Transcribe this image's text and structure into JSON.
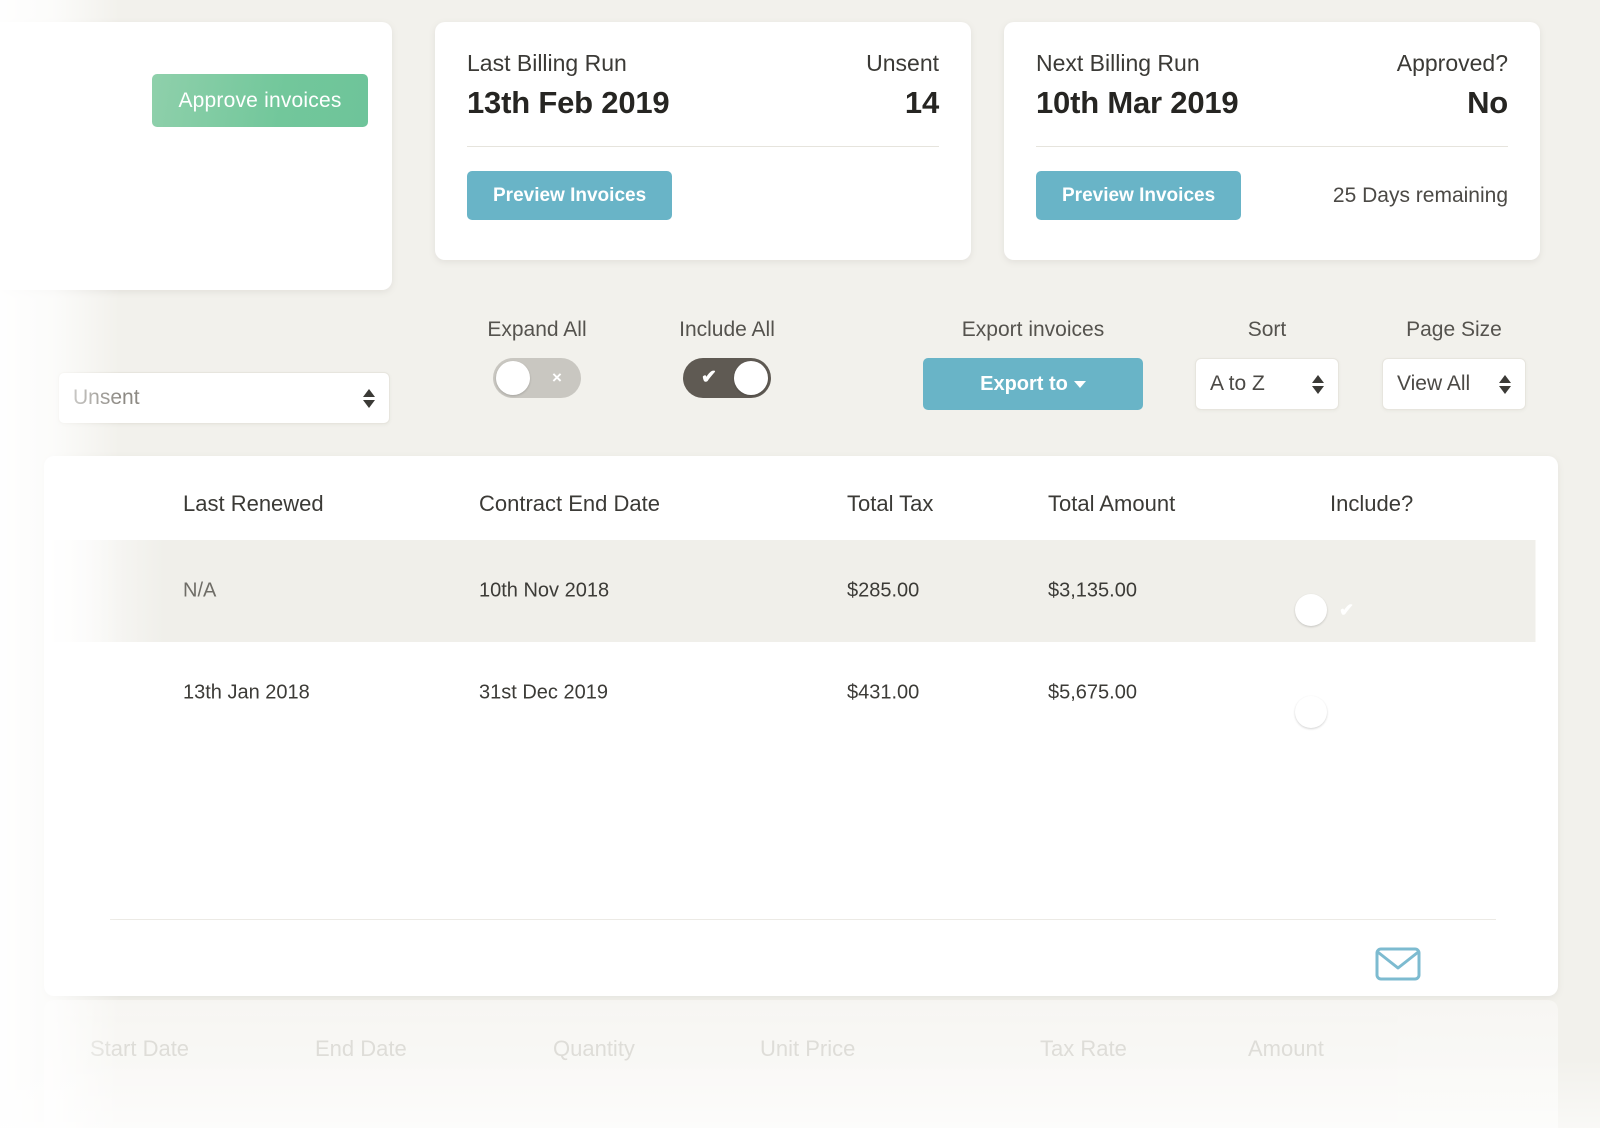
{
  "approve_card": {
    "button_label": "Approve invoices"
  },
  "cards": [
    {
      "label": "Last Billing Run",
      "date": "13th Feb 2019",
      "stat_label": "Unsent",
      "stat_value": "14",
      "button_label": "Preview Invoices",
      "note": ""
    },
    {
      "label": "Next Billing Run",
      "date": "10th Mar 2019",
      "stat_label": "Approved?",
      "stat_value": "No",
      "button_label": "Preview Invoices",
      "note": "25 Days remaining"
    }
  ],
  "toolbar": {
    "status_select_value": "Unsent",
    "expand_all_caption": "Expand All",
    "expand_all_state": "off",
    "expand_all_glyph": "×",
    "include_all_caption": "Include All",
    "include_all_state": "on",
    "include_all_glyph": "✔",
    "export_caption": "Export invoices",
    "export_button_label": "Export to",
    "sort_caption": "Sort",
    "sort_value": "A to Z",
    "page_size_caption": "Page Size",
    "page_size_value": "View All"
  },
  "table": {
    "columns": [
      "Last Renewed",
      "Contract End Date",
      "Total Tax",
      "Total Amount",
      "Include?"
    ],
    "rows": [
      {
        "last_renewed": "N/A",
        "contract_end_date": "10th Nov 2018",
        "total_tax": "$285.00",
        "total_amount": "$3,135.00",
        "include_glyph": "✔",
        "include": "on"
      },
      {
        "last_renewed": "13th Jan 2018",
        "contract_end_date": "31st Dec 2019",
        "total_tax": "$431.00",
        "total_amount": "$5,675.00",
        "include_glyph": "✔",
        "include": "on"
      }
    ],
    "mail_icon": "envelope-icon"
  },
  "subtable": {
    "columns": [
      "Start Date",
      "End Date",
      "Quantity",
      "Unit Price",
      "Tax Rate",
      "Amount"
    ]
  },
  "colors": {
    "page_background": "#f2f1ec",
    "accent_blue": "#69b4c7",
    "accent_green": "#72c79b",
    "toggle_on": "#5f5a53",
    "toggle_off": "#c9c7c1"
  }
}
